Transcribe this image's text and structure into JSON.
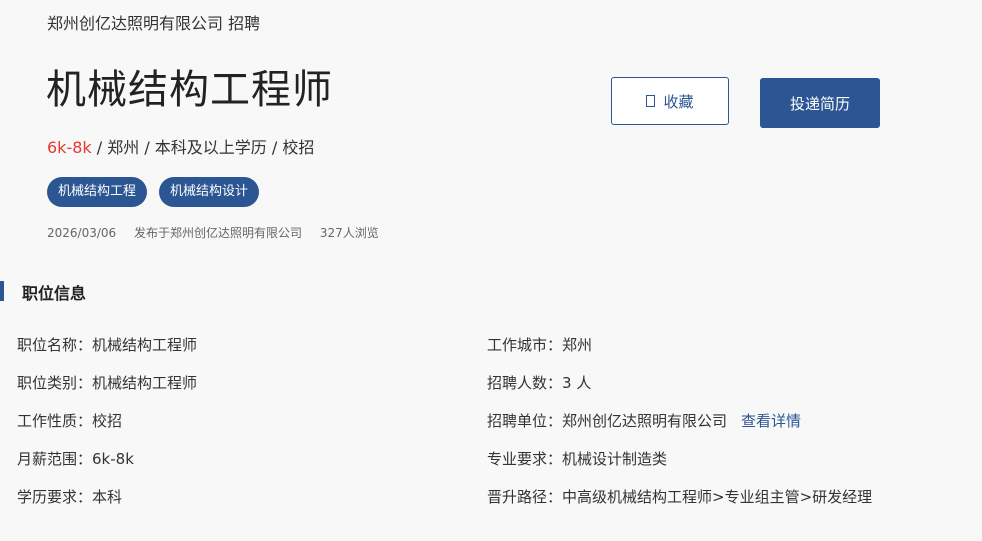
{
  "header": {
    "company_line": "郑州创亿达照明有限公司 招聘",
    "job_title": "机械结构工程师",
    "salary": "6k-8k",
    "summary_rest": " / 郑州 / 本科及以上学历 / 校招",
    "tags": [
      "机械结构工程",
      "机械结构设计"
    ],
    "date": "2026/03/06",
    "publisher": "发布于郑州创亿达照明有限公司",
    "views": "327人浏览"
  },
  "actions": {
    "favorite_label": "收藏",
    "apply_label": "投递简历"
  },
  "section": {
    "title": "职位信息"
  },
  "info_left": [
    {
      "label": "职位名称：",
      "value": "机械结构工程师"
    },
    {
      "label": "职位类别：",
      "value": "机械结构工程师"
    },
    {
      "label": "工作性质：",
      "value": "校招"
    },
    {
      "label": "月薪范围：",
      "value": "6k-8k"
    },
    {
      "label": "学历要求：",
      "value": "本科"
    }
  ],
  "info_right": [
    {
      "label": "工作城市：",
      "value": "郑州"
    },
    {
      "label": "招聘人数：",
      "value": "3 人"
    },
    {
      "label": "招聘单位：",
      "value": "郑州创亿达照明有限公司",
      "link": "查看详情"
    },
    {
      "label": "专业要求：",
      "value": "机械设计制造类"
    },
    {
      "label": "晋升路径：",
      "value": "中高级机械结构工程师>专业组主管>研发经理"
    }
  ],
  "colors": {
    "accent": "#2b5593",
    "salary": "#e53a2d",
    "background": "#f8f8f8"
  }
}
